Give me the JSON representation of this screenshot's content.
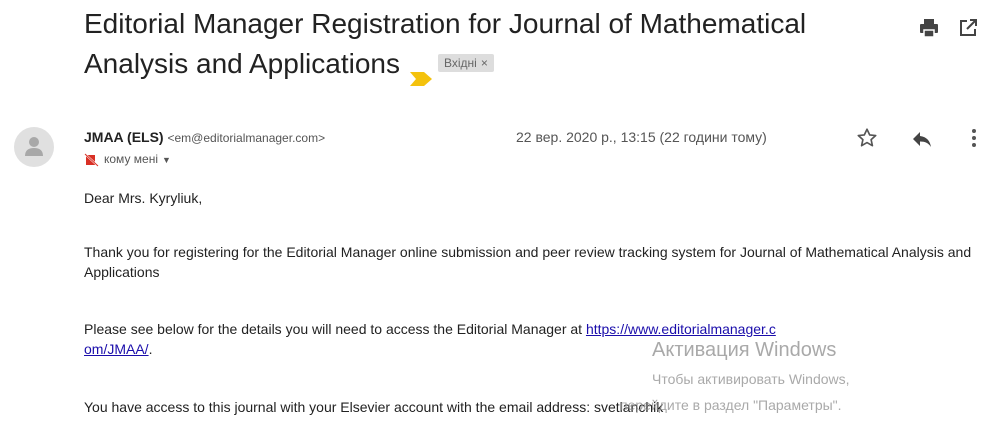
{
  "email": {
    "subject": "Editorial Manager Registration for Journal of Mathematical Analysis and Applications",
    "label": "Вхідні",
    "label_close": "×",
    "sender_name": "JMAA (ELS)",
    "sender_email": "<em@editorialmanager.com>",
    "date": "22 вер. 2020 р., 13:15 (22 години тому)",
    "to": "кому мені",
    "body": {
      "greeting": "Dear Mrs. Kyryliuk,",
      "p1": "Thank you for registering for the Editorial Manager online submission and peer review tracking system for Journal of Mathematical Analysis and Applications",
      "p2_prefix": "Please see below for the details you will need to access the Editorial Manager at ",
      "p2_link_line1": "https://www.editorialmanager.c",
      "p2_link_line2": "om/JMAA/",
      "p2_suffix": ".",
      "p3": "You have access to this journal with your Elsevier account with the email address: svetlanchik"
    }
  },
  "watermark": {
    "line1": "Активация Windows",
    "line2": "Чтобы активировать Windows,",
    "line3": "перейдите в раздел \"Параметры\"."
  },
  "icons": {
    "print": "print-icon",
    "open_new": "open-in-new-window-icon",
    "star": "star-icon",
    "reply": "reply-icon",
    "more": "more-vertical-icon",
    "important": "important-marker-icon",
    "avatar": "default-avatar-icon"
  },
  "colors": {
    "important_marker": "#f4c20d",
    "link": "#1a0dab",
    "unread_icon": "#d93025"
  }
}
